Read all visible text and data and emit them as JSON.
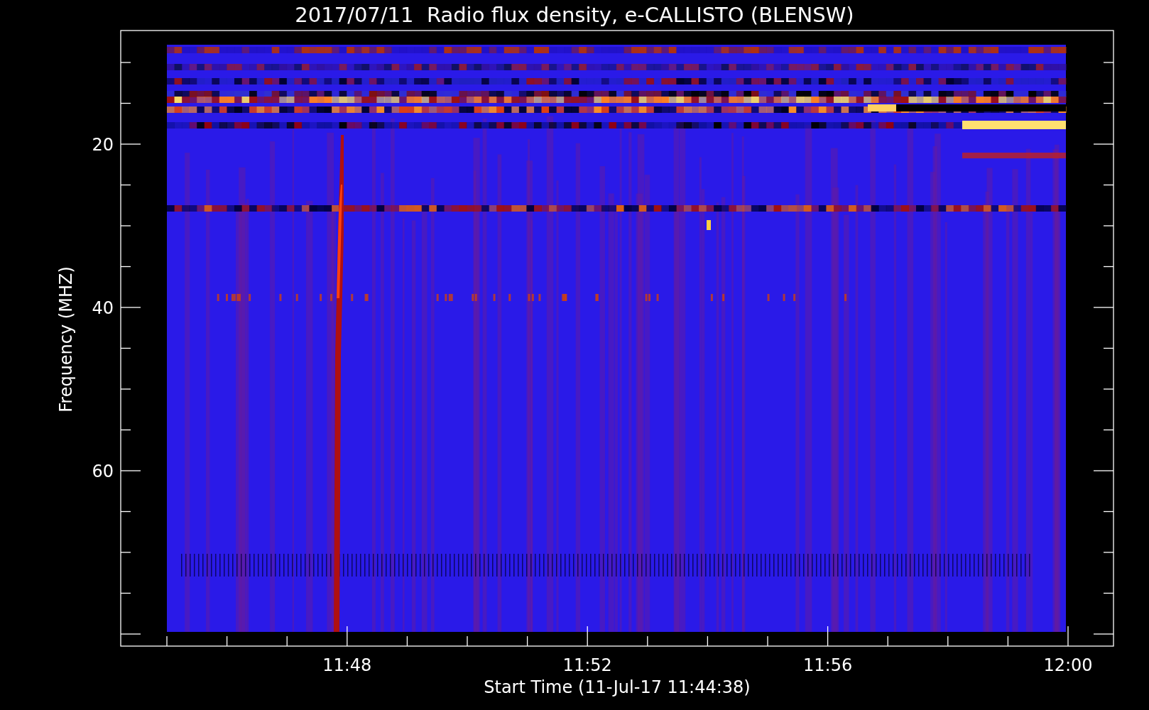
{
  "title": "2017/07/11  Radio flux density, e-CALLISTO (BLENSW)",
  "ylabel": "Frequency (MHZ)",
  "yticks": [
    "20",
    "40",
    "60"
  ],
  "xticks": [
    "11:48",
    "11:52",
    "11:56",
    "12:00"
  ],
  "xlabel": "Start Time (11-Jul-17 11:44:38)"
}
